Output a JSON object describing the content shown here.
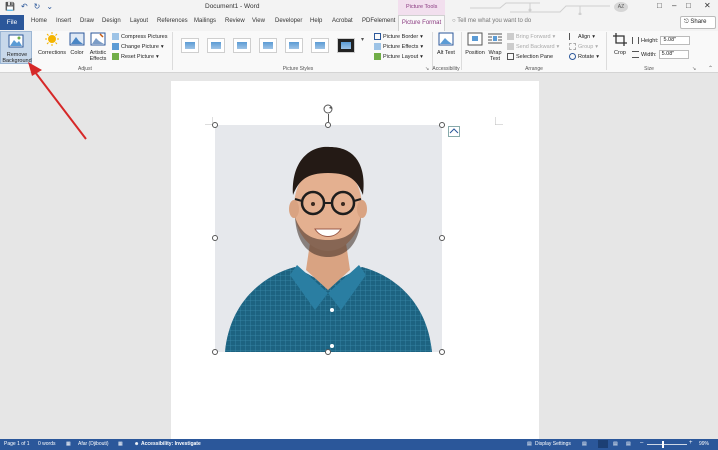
{
  "window": {
    "title": "Document1 - Word",
    "context_label": "Picture Tools",
    "user_initials": "AZ"
  },
  "tabs": [
    "File",
    "Home",
    "Insert",
    "Draw",
    "Design",
    "Layout",
    "References",
    "Mailings",
    "Review",
    "View",
    "Developer",
    "Help",
    "Acrobat",
    "PDFelement",
    "Picture Format"
  ],
  "tell_me": "Tell me what you want to do",
  "share": "Share",
  "ribbon": {
    "adjust": {
      "remove_bg": "Remove Background",
      "corrections": "Corrections",
      "color": "Color",
      "artistic": "Artistic Effects",
      "compress": "Compress Pictures",
      "change": "Change Picture",
      "reset": "Reset Picture",
      "label": "Adjust"
    },
    "styles": {
      "label": "Picture Styles",
      "border": "Picture Border",
      "effects": "Picture Effects",
      "layout": "Picture Layout"
    },
    "accessibility": {
      "alt_text": "Alt Text",
      "label": "Accessibility"
    },
    "arrange": {
      "position": "Position",
      "wrap": "Wrap Text",
      "forward": "Bring Forward",
      "backward": "Send Backward",
      "selection": "Selection Pane",
      "align": "Align",
      "group": "Group",
      "rotate": "Rotate",
      "label": "Arrange"
    },
    "size": {
      "crop": "Crop",
      "height_label": "Height:",
      "height": "5.08\"",
      "width_label": "Width:",
      "width": "5.08\"",
      "label": "Size"
    }
  },
  "status": {
    "page": "Page 1 of 1",
    "words": "0 words",
    "lang": "Afar (Djibouti)",
    "access": "Accessibility: Investigate",
    "display": "Display Settings",
    "zoom": "99%"
  },
  "colors": {
    "accent": "#2b579a",
    "arrow": "#d62828"
  }
}
